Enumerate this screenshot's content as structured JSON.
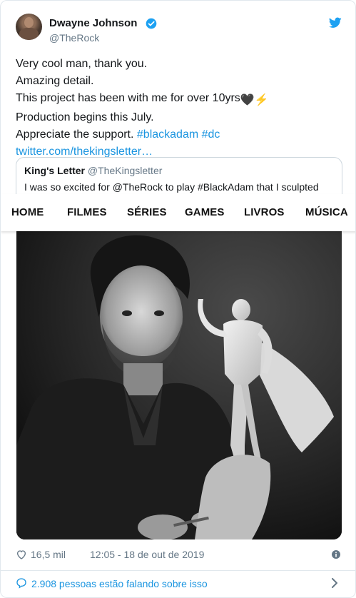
{
  "tweet": {
    "author_name": "Dwayne Johnson",
    "author_handle": "@TheRock",
    "lines": [
      "Very cool man, thank you.",
      "Amazing detail.",
      "This project has been with me for over 10yrs",
      "Production begins this July."
    ],
    "line3_emojis": "🖤⚡",
    "line5_prefix": "Appreciate the support. ",
    "hashtag_blackadam": "#blackadam",
    "hashtag_dc": "#dc",
    "link_text": "twitter.com/thekingsletter…",
    "icons": {
      "verified": "verified-badge-icon",
      "brand": "twitter-bird-icon"
    }
  },
  "quote": {
    "name": "King's Letter",
    "handle": "@TheKingsletter",
    "text": "I was so excited for @TheRock to play #BlackAdam that I sculpted"
  },
  "nav": {
    "items": [
      "HOME",
      "FILMES",
      "SÉRIES",
      "GAMES",
      "LIVROS",
      "MÚSICA"
    ]
  },
  "footer": {
    "likes": "16,5 mil",
    "date": "12:05 - 18 de out de 2019",
    "conversation": "2.908 pessoas estão falando sobre isso"
  },
  "colors": {
    "link": "#1b95e0",
    "verified": "#1da1f2",
    "text": "#14171a",
    "muted": "#657786"
  }
}
